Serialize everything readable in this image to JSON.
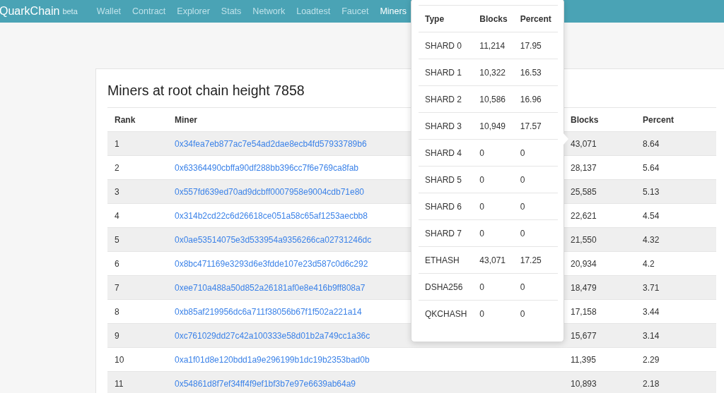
{
  "navbar": {
    "brand": "QuarkChain",
    "brand_tag": "beta",
    "links": [
      {
        "label": "Wallet",
        "selected": false
      },
      {
        "label": "Contract",
        "selected": false
      },
      {
        "label": "Explorer",
        "selected": false
      },
      {
        "label": "Stats",
        "selected": false
      },
      {
        "label": "Network",
        "selected": false
      },
      {
        "label": "Loadtest",
        "selected": false
      },
      {
        "label": "Faucet",
        "selected": false
      },
      {
        "label": "Miners",
        "selected": true
      }
    ]
  },
  "title": "Miners at root chain height 7858",
  "table": {
    "columns": [
      "Rank",
      "Miner",
      "Blocks",
      "Percent"
    ],
    "rows": [
      {
        "rank": "1",
        "miner": "0x34fea7eb877ac7e54ad2dae8ecb4fd57933789b6",
        "blocks": "43,071",
        "percent": "8.64"
      },
      {
        "rank": "2",
        "miner": "0x63364490cbffa90df288bb396cc7f6e769ca8fab",
        "blocks": "28,137",
        "percent": "5.64"
      },
      {
        "rank": "3",
        "miner": "0x557fd639ed70ad9dcbff0007958e9004cdb71e80",
        "blocks": "25,585",
        "percent": "5.13"
      },
      {
        "rank": "4",
        "miner": "0x314b2cd22c6d26618ce051a58c65af1253aecbb8",
        "blocks": "22,621",
        "percent": "4.54"
      },
      {
        "rank": "5",
        "miner": "0x0ae53514075e3d533954a9356266ca02731246dc",
        "blocks": "21,550",
        "percent": "4.32"
      },
      {
        "rank": "6",
        "miner": "0x8bc471169e3293d6e3fdde107e23d587c0d6c292",
        "blocks": "20,934",
        "percent": "4.2"
      },
      {
        "rank": "7",
        "miner": "0xee710a488a50d852a26181af0e8e416b9ff808a7",
        "blocks": "18,479",
        "percent": "3.71"
      },
      {
        "rank": "8",
        "miner": "0xb85af219956dc6a711f38056b67f1f502a221a14",
        "blocks": "17,158",
        "percent": "3.44"
      },
      {
        "rank": "9",
        "miner": "0xc761029dd27c42a100333e58d01b2a749cc1a36c",
        "blocks": "15,677",
        "percent": "3.14"
      },
      {
        "rank": "10",
        "miner": "0xa1f01d8e120bdd1a9e296199b1dc19b2353bad0b",
        "blocks": "11,395",
        "percent": "2.29"
      },
      {
        "rank": "11",
        "miner": "0x54861d8f7ef34ff4f9ef1bf3b7e97e6639ab64a9",
        "blocks": "10,893",
        "percent": "2.18"
      }
    ]
  },
  "popover": {
    "columns": [
      "Type",
      "Blocks",
      "Percent"
    ],
    "rows": [
      {
        "type": "SHARD 0",
        "blocks": "11,214",
        "percent": "17.95"
      },
      {
        "type": "SHARD 1",
        "blocks": "10,322",
        "percent": "16.53"
      },
      {
        "type": "SHARD 2",
        "blocks": "10,586",
        "percent": "16.96"
      },
      {
        "type": "SHARD 3",
        "blocks": "10,949",
        "percent": "17.57"
      },
      {
        "type": "SHARD 4",
        "blocks": "0",
        "percent": "0"
      },
      {
        "type": "SHARD 5",
        "blocks": "0",
        "percent": "0"
      },
      {
        "type": "SHARD 6",
        "blocks": "0",
        "percent": "0"
      },
      {
        "type": "SHARD 7",
        "blocks": "0",
        "percent": "0"
      },
      {
        "type": "ETHASH",
        "blocks": "43,071",
        "percent": "17.25"
      },
      {
        "type": "DSHA256",
        "blocks": "0",
        "percent": "0"
      },
      {
        "type": "QKCHASH",
        "blocks": "0",
        "percent": "0"
      }
    ]
  }
}
